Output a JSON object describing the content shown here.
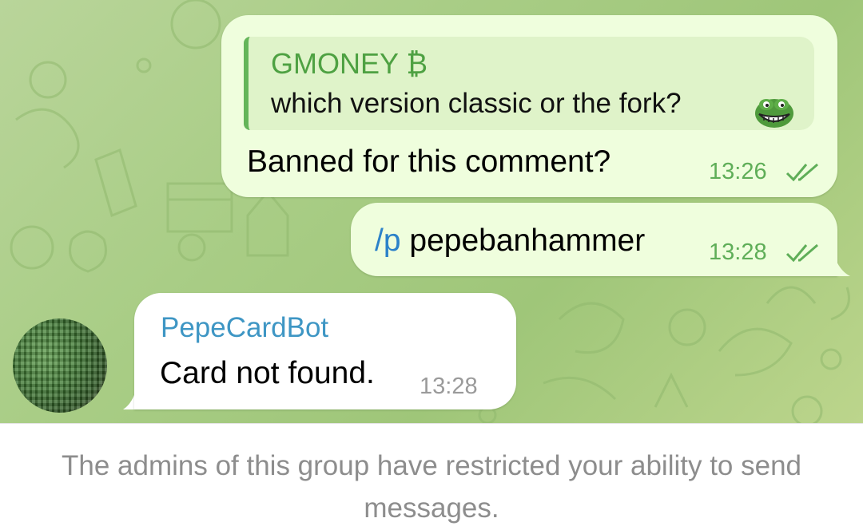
{
  "messages": [
    {
      "direction": "outgoing",
      "reply": {
        "author": "GMONEY ₿",
        "text": "which version classic or the fork?",
        "emoji": "pepe-grin-icon"
      },
      "text": "Banned for this comment?",
      "time": "13:26",
      "status": "read"
    },
    {
      "direction": "outgoing",
      "command": "/p",
      "text": "pepebanhammer",
      "time": "13:28",
      "status": "read"
    },
    {
      "direction": "incoming",
      "sender": "PepeCardBot",
      "text": "Card not found.",
      "time": "13:28"
    }
  ],
  "footer": {
    "restricted_notice": "The admins of this group have restricted your ability to send messages."
  },
  "colors": {
    "outgoing_bubble": "#effedd",
    "incoming_bubble": "#ffffff",
    "reply_accent": "#64b559",
    "sender_name": "#3e96c4",
    "read_ticks": "#5fae58",
    "chat_background": "#a9cd86"
  }
}
